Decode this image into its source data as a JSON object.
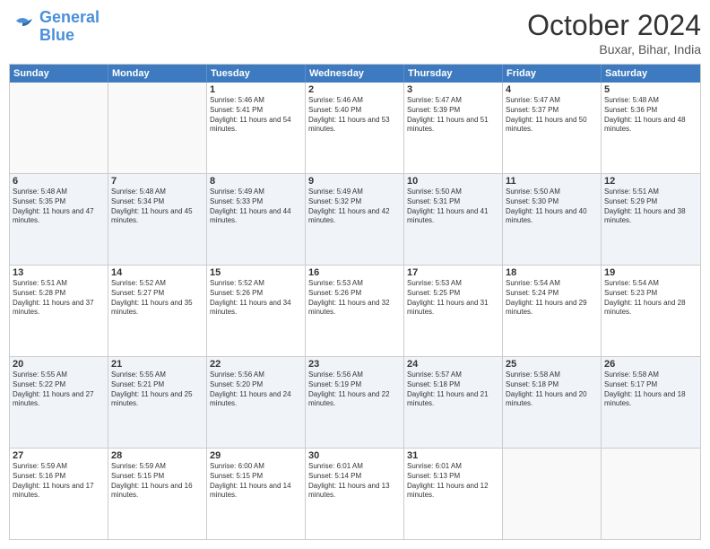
{
  "logo": {
    "line1": "General",
    "line2": "Blue"
  },
  "title": "October 2024",
  "subtitle": "Buxar, Bihar, India",
  "days": [
    "Sunday",
    "Monday",
    "Tuesday",
    "Wednesday",
    "Thursday",
    "Friday",
    "Saturday"
  ],
  "rows": [
    [
      {
        "day": "",
        "info": ""
      },
      {
        "day": "",
        "info": ""
      },
      {
        "day": "1",
        "info": "Sunrise: 5:46 AM\nSunset: 5:41 PM\nDaylight: 11 hours and 54 minutes."
      },
      {
        "day": "2",
        "info": "Sunrise: 5:46 AM\nSunset: 5:40 PM\nDaylight: 11 hours and 53 minutes."
      },
      {
        "day": "3",
        "info": "Sunrise: 5:47 AM\nSunset: 5:39 PM\nDaylight: 11 hours and 51 minutes."
      },
      {
        "day": "4",
        "info": "Sunrise: 5:47 AM\nSunset: 5:37 PM\nDaylight: 11 hours and 50 minutes."
      },
      {
        "day": "5",
        "info": "Sunrise: 5:48 AM\nSunset: 5:36 PM\nDaylight: 11 hours and 48 minutes."
      }
    ],
    [
      {
        "day": "6",
        "info": "Sunrise: 5:48 AM\nSunset: 5:35 PM\nDaylight: 11 hours and 47 minutes."
      },
      {
        "day": "7",
        "info": "Sunrise: 5:48 AM\nSunset: 5:34 PM\nDaylight: 11 hours and 45 minutes."
      },
      {
        "day": "8",
        "info": "Sunrise: 5:49 AM\nSunset: 5:33 PM\nDaylight: 11 hours and 44 minutes."
      },
      {
        "day": "9",
        "info": "Sunrise: 5:49 AM\nSunset: 5:32 PM\nDaylight: 11 hours and 42 minutes."
      },
      {
        "day": "10",
        "info": "Sunrise: 5:50 AM\nSunset: 5:31 PM\nDaylight: 11 hours and 41 minutes."
      },
      {
        "day": "11",
        "info": "Sunrise: 5:50 AM\nSunset: 5:30 PM\nDaylight: 11 hours and 40 minutes."
      },
      {
        "day": "12",
        "info": "Sunrise: 5:51 AM\nSunset: 5:29 PM\nDaylight: 11 hours and 38 minutes."
      }
    ],
    [
      {
        "day": "13",
        "info": "Sunrise: 5:51 AM\nSunset: 5:28 PM\nDaylight: 11 hours and 37 minutes."
      },
      {
        "day": "14",
        "info": "Sunrise: 5:52 AM\nSunset: 5:27 PM\nDaylight: 11 hours and 35 minutes."
      },
      {
        "day": "15",
        "info": "Sunrise: 5:52 AM\nSunset: 5:26 PM\nDaylight: 11 hours and 34 minutes."
      },
      {
        "day": "16",
        "info": "Sunrise: 5:53 AM\nSunset: 5:26 PM\nDaylight: 11 hours and 32 minutes."
      },
      {
        "day": "17",
        "info": "Sunrise: 5:53 AM\nSunset: 5:25 PM\nDaylight: 11 hours and 31 minutes."
      },
      {
        "day": "18",
        "info": "Sunrise: 5:54 AM\nSunset: 5:24 PM\nDaylight: 11 hours and 29 minutes."
      },
      {
        "day": "19",
        "info": "Sunrise: 5:54 AM\nSunset: 5:23 PM\nDaylight: 11 hours and 28 minutes."
      }
    ],
    [
      {
        "day": "20",
        "info": "Sunrise: 5:55 AM\nSunset: 5:22 PM\nDaylight: 11 hours and 27 minutes."
      },
      {
        "day": "21",
        "info": "Sunrise: 5:55 AM\nSunset: 5:21 PM\nDaylight: 11 hours and 25 minutes."
      },
      {
        "day": "22",
        "info": "Sunrise: 5:56 AM\nSunset: 5:20 PM\nDaylight: 11 hours and 24 minutes."
      },
      {
        "day": "23",
        "info": "Sunrise: 5:56 AM\nSunset: 5:19 PM\nDaylight: 11 hours and 22 minutes."
      },
      {
        "day": "24",
        "info": "Sunrise: 5:57 AM\nSunset: 5:18 PM\nDaylight: 11 hours and 21 minutes."
      },
      {
        "day": "25",
        "info": "Sunrise: 5:58 AM\nSunset: 5:18 PM\nDaylight: 11 hours and 20 minutes."
      },
      {
        "day": "26",
        "info": "Sunrise: 5:58 AM\nSunset: 5:17 PM\nDaylight: 11 hours and 18 minutes."
      }
    ],
    [
      {
        "day": "27",
        "info": "Sunrise: 5:59 AM\nSunset: 5:16 PM\nDaylight: 11 hours and 17 minutes."
      },
      {
        "day": "28",
        "info": "Sunrise: 5:59 AM\nSunset: 5:15 PM\nDaylight: 11 hours and 16 minutes."
      },
      {
        "day": "29",
        "info": "Sunrise: 6:00 AM\nSunset: 5:15 PM\nDaylight: 11 hours and 14 minutes."
      },
      {
        "day": "30",
        "info": "Sunrise: 6:01 AM\nSunset: 5:14 PM\nDaylight: 11 hours and 13 minutes."
      },
      {
        "day": "31",
        "info": "Sunrise: 6:01 AM\nSunset: 5:13 PM\nDaylight: 11 hours and 12 minutes."
      },
      {
        "day": "",
        "info": ""
      },
      {
        "day": "",
        "info": ""
      }
    ]
  ]
}
